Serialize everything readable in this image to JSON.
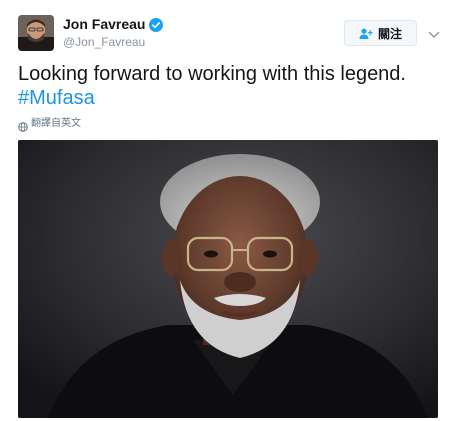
{
  "user": {
    "display_name": "Jon Favreau",
    "handle": "@Jon_Favreau"
  },
  "follow_button": {
    "label": "關注"
  },
  "tweet": {
    "text": "Looking forward to working with this legend.",
    "hashtag": "#Mufasa"
  },
  "translate": {
    "label": "翻譯自英文"
  },
  "colors": {
    "link": "#1b95e0",
    "verified": "#1da1f2",
    "text": "#14171a",
    "muted": "#8a949e"
  },
  "icons": {
    "verified": "verified-badge-icon",
    "follow": "add-user-icon",
    "caret": "chevron-down-icon",
    "translate": "globe-icon"
  }
}
